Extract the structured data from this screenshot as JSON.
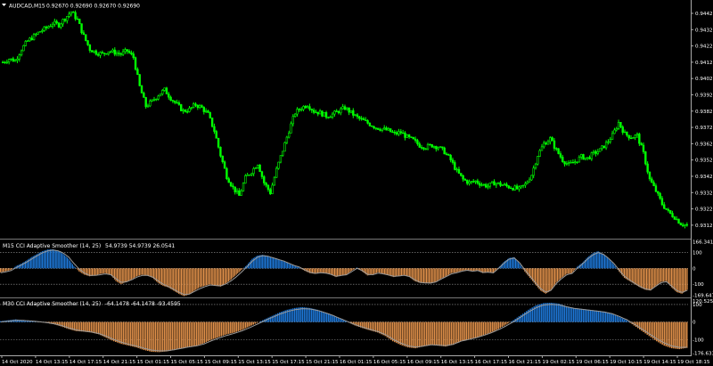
{
  "main_pane": {
    "header_symbol": "AUDCAD,M15",
    "header_ohlc": "0.92670 0.92690 0.92670 0.92690",
    "price_axis": [
      "0.94420",
      "0.94320",
      "0.94220",
      "0.94120",
      "0.94020",
      "0.93920",
      "0.93820",
      "0.93720",
      "0.93620",
      "0.93520",
      "0.93420",
      "0.93320",
      "0.93220",
      "0.93120"
    ],
    "close_series": [
      0.9412,
      0.9414,
      0.9413,
      0.942,
      0.9425,
      0.9428,
      0.9431,
      0.9433,
      0.9436,
      0.9435,
      0.9439,
      0.9443,
      0.9438,
      0.9428,
      0.942,
      0.9418,
      0.9417,
      0.9419,
      0.9418,
      0.9417,
      0.9419,
      0.9415,
      0.9397,
      0.9385,
      0.9388,
      0.9392,
      0.9395,
      0.939,
      0.9386,
      0.9382,
      0.9383,
      0.9386,
      0.9384,
      0.938,
      0.937,
      0.9355,
      0.9342,
      0.9335,
      0.933,
      0.9341,
      0.9345,
      0.935,
      0.9338,
      0.9332,
      0.9346,
      0.9358,
      0.937,
      0.9381,
      0.9384,
      0.9386,
      0.9382,
      0.9381,
      0.9379,
      0.938,
      0.9382,
      0.9384,
      0.9381,
      0.9378,
      0.9376,
      0.9374,
      0.9372,
      0.9371,
      0.937,
      0.9368,
      0.9369,
      0.9366,
      0.9364,
      0.9361,
      0.936,
      0.9361,
      0.936,
      0.9357,
      0.9352,
      0.9345,
      0.934,
      0.9338,
      0.9339,
      0.9337,
      0.9336,
      0.9338,
      0.9337,
      0.9336,
      0.9335,
      0.9334,
      0.9337,
      0.9343,
      0.9355,
      0.9362,
      0.9365,
      0.9358,
      0.9352,
      0.9349,
      0.9351,
      0.9354,
      0.9353,
      0.9356,
      0.9358,
      0.9362,
      0.9367,
      0.9375,
      0.9368,
      0.9366,
      0.9367,
      0.9356,
      0.934,
      0.9333,
      0.9325,
      0.932,
      0.9317,
      0.9313,
      0.9312
    ]
  },
  "indicator1": {
    "header_name": "M15 CCI Adaptive Smoother (14, 25)",
    "header_values": "54.9739 54.9739 26.0541",
    "axis_labels": [
      "166.3414",
      "100",
      "0",
      "-100",
      "-169.6471"
    ],
    "histogram": [
      -25,
      -18,
      -10,
      15,
      30,
      50,
      72,
      90,
      108,
      118,
      120,
      110,
      90,
      60,
      15,
      -20,
      -40,
      -50,
      -45,
      -35,
      -30,
      -40,
      -80,
      -100,
      -85,
      -70,
      -50,
      -40,
      -45,
      -60,
      -90,
      -110,
      -120,
      -140,
      -160,
      -175,
      -165,
      -140,
      -120,
      -110,
      -100,
      -110,
      -115,
      -95,
      -70,
      -40,
      -10,
      20,
      60,
      80,
      85,
      78,
      65,
      55,
      45,
      30,
      15,
      5,
      -15,
      -30,
      -35,
      -25,
      -30,
      -40,
      -55,
      -45,
      -40,
      -15,
      5,
      -20,
      -45,
      -40,
      -25,
      -35,
      -45,
      -55,
      -48,
      -42,
      -55,
      -80,
      -92,
      -92,
      -95,
      -85,
      -65,
      -50,
      -30,
      -25,
      -15,
      -10,
      -20,
      -12,
      -30,
      -25,
      -30,
      5,
      40,
      65,
      70,
      30,
      -20,
      -60,
      -100,
      -140,
      -160,
      -140,
      -90,
      -60,
      -35,
      -30,
      10,
      35,
      70,
      95,
      108,
      90,
      60,
      25,
      -20,
      -60,
      -80,
      -100,
      -120,
      -135,
      -140,
      -110,
      -85,
      -80,
      -120,
      -150,
      -160,
      -135
    ],
    "signal": [
      -28,
      -22,
      -14,
      5,
      22,
      40,
      60,
      80,
      98,
      110,
      115,
      110,
      95,
      70,
      30,
      -5,
      -30,
      -45,
      -45,
      -40,
      -35,
      -40,
      -65,
      -88,
      -85,
      -72,
      -55,
      -45,
      -45,
      -55,
      -78,
      -100,
      -115,
      -132,
      -150,
      -165,
      -162,
      -145,
      -128,
      -115,
      -105,
      -108,
      -110,
      -98,
      -78,
      -52,
      -22,
      10,
      45,
      70,
      80,
      76,
      66,
      56,
      46,
      32,
      18,
      8,
      -10,
      -25,
      -32,
      -28,
      -30,
      -38,
      -50,
      -45,
      -40,
      -20,
      0,
      -15,
      -38,
      -40,
      -30,
      -35,
      -42,
      -50,
      -48,
      -44,
      -52,
      -72,
      -88,
      -92,
      -93,
      -86,
      -68,
      -52,
      -35,
      -28,
      -18,
      -12,
      -18,
      -14,
      -26,
      -25,
      -28,
      0,
      32,
      58,
      65,
      35,
      -10,
      -50,
      -90,
      -128,
      -150,
      -138,
      -95,
      -65,
      -40,
      -32,
      0,
      28,
      60,
      85,
      100,
      88,
      62,
      30,
      -12,
      -50,
      -74,
      -95,
      -115,
      -130,
      -136,
      -112,
      -90,
      -84,
      -112,
      -140,
      -152,
      -138
    ]
  },
  "indicator2": {
    "header_name": "M30 CCI Adaptive Smoother (14, 25)",
    "header_values": "-64.1478 -64.1478 -93.4595",
    "axis_labels": [
      "120.5252",
      "100",
      "0",
      "-100",
      "-176.6335"
    ],
    "histogram": [
      5,
      10,
      15,
      10,
      5,
      0,
      -5,
      -12,
      -25,
      -40,
      -52,
      -55,
      -60,
      -70,
      -90,
      -110,
      -125,
      -135,
      -145,
      -160,
      -170,
      -172,
      -168,
      -160,
      -150,
      -140,
      -135,
      -120,
      -100,
      -85,
      -70,
      -60,
      -45,
      -25,
      -5,
      15,
      35,
      55,
      70,
      80,
      85,
      80,
      70,
      55,
      40,
      20,
      0,
      -20,
      -35,
      -48,
      -60,
      -80,
      -110,
      -130,
      -145,
      -150,
      -140,
      -130,
      -135,
      -140,
      -130,
      -110,
      -100,
      -90,
      -75,
      -60,
      -40,
      -15,
      10,
      40,
      70,
      95,
      108,
      110,
      105,
      90,
      80,
      75,
      70,
      65,
      60,
      50,
      30,
      10,
      -20,
      -50,
      -80,
      -110,
      -135,
      -150,
      -155,
      -148
    ],
    "signal": [
      0,
      5,
      10,
      9,
      6,
      2,
      -3,
      -10,
      -20,
      -34,
      -46,
      -52,
      -57,
      -66,
      -82,
      -100,
      -116,
      -128,
      -138,
      -150,
      -160,
      -165,
      -164,
      -158,
      -150,
      -142,
      -136,
      -124,
      -106,
      -90,
      -76,
      -64,
      -50,
      -32,
      -12,
      8,
      27,
      45,
      60,
      70,
      76,
      74,
      66,
      53,
      38,
      20,
      2,
      -16,
      -30,
      -43,
      -55,
      -72,
      -98,
      -120,
      -136,
      -143,
      -138,
      -130,
      -132,
      -135,
      -127,
      -110,
      -100,
      -90,
      -77,
      -62,
      -44,
      -22,
      2,
      30,
      58,
      82,
      97,
      101,
      98,
      87,
      78,
      73,
      68,
      63,
      57,
      48,
      32,
      13,
      -12,
      -40,
      -68,
      -96,
      -120,
      -137,
      -145,
      -144
    ]
  },
  "time_axis": [
    "14 Oct 2020",
    "14 Oct 13:15",
    "14 Oct 17:15",
    "14 Oct 21:15",
    "15 Oct 01:15",
    "15 Oct 05:15",
    "15 Oct 09:15",
    "15 Oct 13:15",
    "15 Oct 17:15",
    "15 Oct 21:15",
    "16 Oct 01:15",
    "16 Oct 05:15",
    "16 Oct 09:15",
    "16 Oct 13:15",
    "16 Oct 17:15",
    "16 Oct 21:15",
    "19 Oct 02:15",
    "19 Oct 06:15",
    "19 Oct 10:15",
    "19 Oct 14:15",
    "19 Oct 18:15"
  ],
  "colors": {
    "background": "#000000",
    "bull_candle": "#00ff00",
    "positive_hist": "#1e78d8",
    "negative_hist": "#e0904a",
    "signal_line": "#9a9a9a",
    "grid_dotted": "#9a9a9a",
    "text": "#ffffff"
  }
}
